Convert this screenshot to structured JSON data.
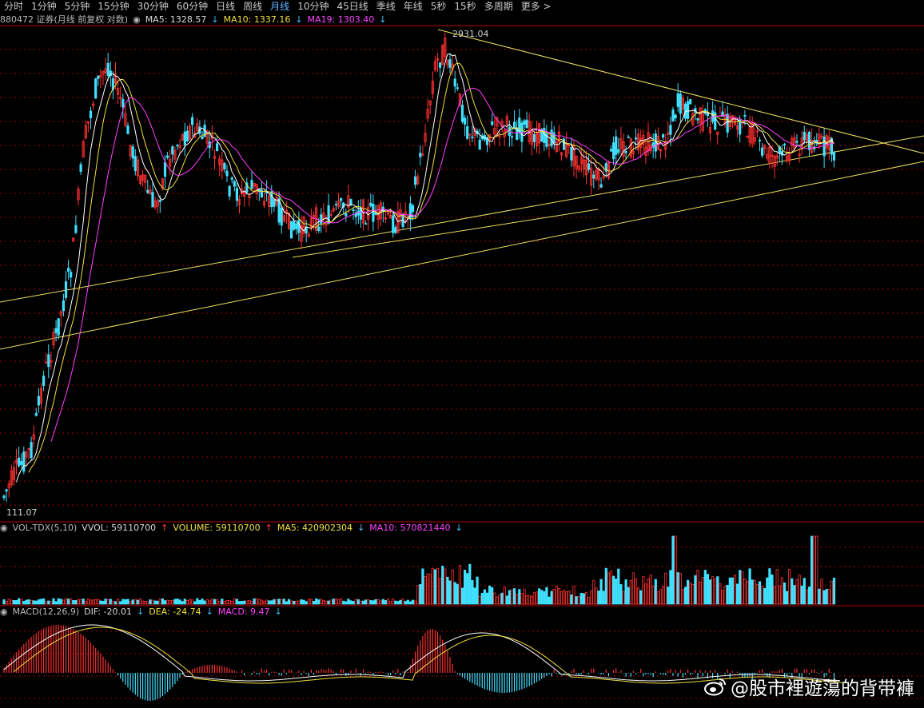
{
  "toolbar": {
    "tabs": [
      "分时",
      "1分钟",
      "5分钟",
      "15分钟",
      "30分钟",
      "60分钟",
      "日线",
      "周线",
      "月线",
      "10分钟",
      "45日线",
      "季线",
      "年线",
      "5秒",
      "15秒",
      "多周期",
      "更多"
    ],
    "active": "月线"
  },
  "price_panel": {
    "code_title": "880472 证券(月线 前复权 对数)",
    "ma5": "MA5: 1328.57",
    "ma10": "MA10: 1337.16",
    "ma19": "MA19: 1303.40",
    "high_label": "2931.04",
    "low_label": "111.07"
  },
  "volume_panel": {
    "indicator": "VOL-TDX(5,10)",
    "vvol": "VVOL: 59110700",
    "volume": "VOLUME: 59110700",
    "ma5": "MA5: 420902304",
    "ma10": "MA10: 570821440"
  },
  "macd_panel": {
    "indicator": "MACD(12,26,9)",
    "dif": "DIF: -20.01",
    "dea": "DEA: -24.74",
    "macd": "MACD: 9.47"
  },
  "watermark": {
    "text": "@股市裡遊蕩的背带褲"
  },
  "colors": {
    "up": "#ff3030",
    "down": "#40e0ff",
    "ma5": "#ffffff",
    "ma10": "#f0e040",
    "ma19": "#ff40ff",
    "trendline": "#e8e060",
    "grid": "#a00000"
  }
}
